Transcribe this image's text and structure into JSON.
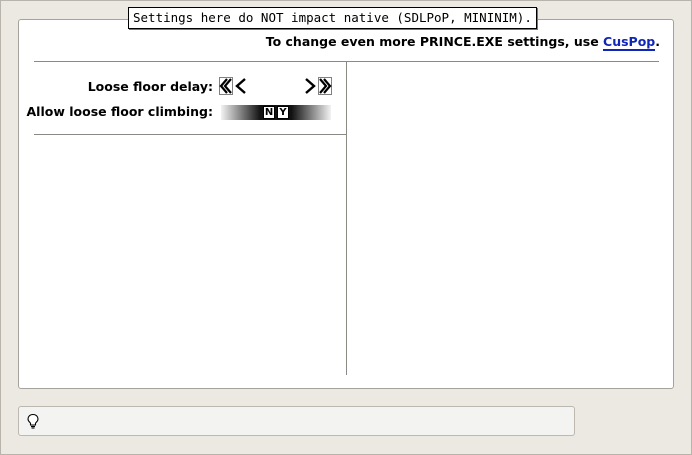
{
  "banner": {
    "text": "Settings here do NOT impact native (SDLPoP, MININIM)."
  },
  "header": {
    "info_prefix": "To change even more PRINCE.EXE settings, use ",
    "link_label": "CusPop",
    "info_suffix": "."
  },
  "settings": {
    "loose_floor_delay": {
      "label": "Loose floor delay:"
    },
    "allow_climbing": {
      "label": "Allow loose floor climbing:",
      "options": [
        "N",
        "Y"
      ]
    }
  },
  "status": {
    "icon": "lightbulb-icon",
    "text": ""
  },
  "colors": {
    "link": "#1026b8",
    "panel_bg": "#ffffff",
    "window_bg": "#ece9e2"
  }
}
